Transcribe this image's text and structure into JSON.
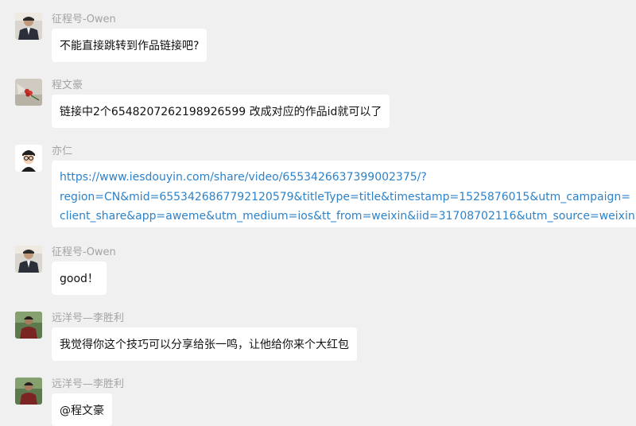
{
  "messages": [
    {
      "sender": "征程号-Owen",
      "avatar": "man-suit-avatar",
      "lines": [
        "不能直接跳转到作品链接吧?"
      ],
      "is_link": false
    },
    {
      "sender": "程文豪",
      "avatar": "roses-avatar",
      "lines": [
        "链接中2个6548207262198926599 改成对应的作品id就可以了"
      ],
      "is_link": false
    },
    {
      "sender": "亦仁",
      "avatar": "cartoon-glasses-avatar",
      "lines": [
        "https://www.iesdouyin.com/share/video/6553426637399002375/?",
        "region=CN&mid=6553426867792120579&titleType=title&timestamp=1525876015&utm_campaign=",
        "client_share&app=aweme&utm_medium=ios&tt_from=weixin&iid=31708702116&utm_source=weixin"
      ],
      "is_link": true
    },
    {
      "sender": "征程号-Owen",
      "avatar": "man-suit-avatar",
      "lines": [
        "good！"
      ],
      "is_link": false
    },
    {
      "sender": "远洋号—李胜利",
      "avatar": "man-red-shirt-avatar",
      "lines": [
        "我觉得你这个技巧可以分享给张一鸣，让他给你来个大红包"
      ],
      "is_link": false
    },
    {
      "sender": "远洋号—李胜利",
      "avatar": "man-red-shirt-avatar",
      "lines": [
        "@程文豪"
      ],
      "is_link": false
    }
  ],
  "colors": {
    "background": "#f0f0f0",
    "bubble": "#ffffff",
    "sender_name": "#a3a3a3",
    "link": "#2e82c8"
  }
}
